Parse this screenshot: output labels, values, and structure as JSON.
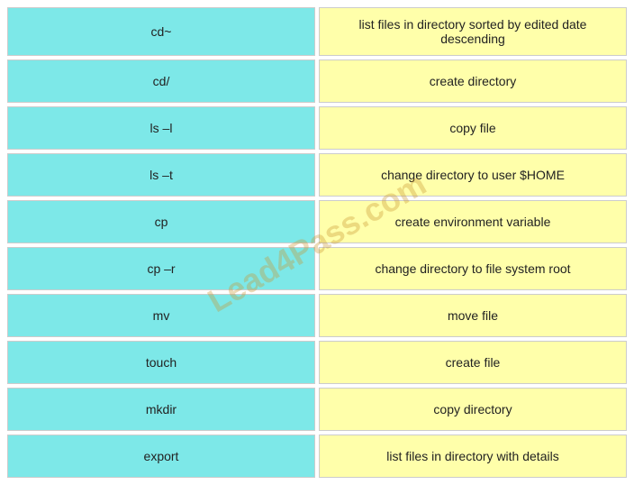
{
  "watermark": "Lead4Pass.com",
  "rows": [
    {
      "command": "cd~",
      "description": "list files in directory sorted by edited date descending"
    },
    {
      "command": "cd/",
      "description": "create directory"
    },
    {
      "command": "ls –l",
      "description": "copy file"
    },
    {
      "command": "ls –t",
      "description": "change directory to user $HOME"
    },
    {
      "command": "cp",
      "description": "create environment variable"
    },
    {
      "command": "cp –r",
      "description": "change directory to file system root"
    },
    {
      "command": "mv",
      "description": "move file"
    },
    {
      "command": "touch",
      "description": "create file"
    },
    {
      "command": "mkdir",
      "description": "copy directory"
    },
    {
      "command": "export",
      "description": "list files in directory with details"
    }
  ]
}
